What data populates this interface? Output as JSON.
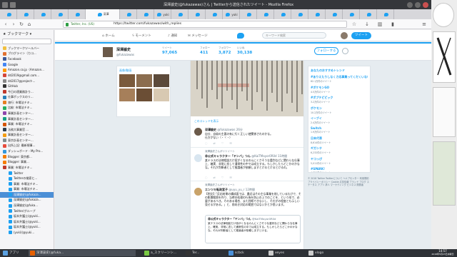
{
  "window": {
    "title": "深澤諭史(@fukazawas)さん | Twitterから送信されたツイート - Mozilla Firefox"
  },
  "tabs": [
    {
      "label": ""
    },
    {
      "label": ""
    },
    {
      "label": ""
    },
    {
      "label": ""
    },
    {
      "label": ""
    },
    {
      "label": "深澤",
      "active": true
    },
    {
      "label": ""
    },
    {
      "label": ""
    },
    {
      "label": "yuki"
    },
    {
      "label": ""
    },
    {
      "label": ""
    },
    {
      "label": ""
    },
    {
      "label": "yuki"
    },
    {
      "label": ""
    },
    {
      "label": ""
    },
    {
      "label": ""
    },
    {
      "label": ""
    },
    {
      "label": ""
    },
    {
      "label": ""
    },
    {
      "label": ""
    },
    {
      "label": ""
    },
    {
      "label": ""
    }
  ],
  "navbar": {
    "site_identity": "Twitter, Inc. (US)",
    "url": "https://twitter.com/fukazawas/with_replies"
  },
  "sidebar": {
    "title": "ブックマーク",
    "items": [
      {
        "label": "ブックマークツールバー",
        "color": "#f0c040"
      },
      {
        "label": "ブログライン（カコ...",
        "color": "#e07030"
      },
      {
        "label": "Facebook",
        "color": "#3b5998"
      },
      {
        "label": "Google",
        "color": "#4285f4"
      },
      {
        "label": "Amazon.co.jp（Amazon...",
        "color": "#ff9900"
      },
      {
        "label": "dd2019@gmail.com...",
        "color": "#d44638"
      },
      {
        "label": "dd2017@project-...",
        "color": "#888888"
      },
      {
        "label": "GitHub",
        "color": "#333333"
      },
      {
        "label": "今日の適業務計り...",
        "color": "#c0392b"
      },
      {
        "label": "仕事ボックスのリ...",
        "color": "#2980b9"
      },
      {
        "label": "旅行: 市場法チキ...",
        "color": "#e67e22"
      },
      {
        "label": "比較: 市場法チキ...",
        "color": "#27ae60"
      },
      {
        "label": "事業計画センター...",
        "color": "#8e44ad"
      },
      {
        "label": "事業計画センター...",
        "color": "#16a085"
      },
      {
        "label": "事業: 市場法チキ...",
        "color": "#d35400"
      },
      {
        "label": "法務大事業官 ...",
        "color": "#2c3e50"
      },
      {
        "label": "事業計画センター...",
        "color": "#f39c12"
      },
      {
        "label": "東京計画センター...",
        "color": "#7f8c8d"
      },
      {
        "label": "出所上記: 最新規事...",
        "color": "#e74c3c"
      },
      {
        "label": "ダッシュボード - My Pro...",
        "color": "#3498db"
      },
      {
        "label": "Blogger: 東京都...",
        "color": "#f57d00"
      },
      {
        "label": "Blogger: 事業...",
        "color": "#f57d00"
      },
      {
        "label": "事業: 市場法チキ...",
        "color": "#c0392b"
      },
      {
        "label": "Twitter",
        "color": "#1da1f2"
      },
      {
        "label": "Twitterの検索と...",
        "color": "#1da1f2"
      },
      {
        "label": "事業: 市場法チキ...",
        "color": "#1da1f2"
      },
      {
        "label": "事業: 市場法チキ...",
        "color": "#1da1f2"
      },
      {
        "label": "深澤諭史(@fukaza...",
        "color": "#1da1f2",
        "selected": true
      },
      {
        "label": "深澤諭史(@fukaza...",
        "color": "#1da1f2"
      },
      {
        "label": "深澤諭史(@fuka...",
        "color": "#1da1f2"
      },
      {
        "label": "Twitter/グループ",
        "color": "#1da1f2"
      },
      {
        "label": "坂本弁護士(@yuki...",
        "color": "#1da1f2"
      },
      {
        "label": "坂本弁護士(@yuki...",
        "color": "#1da1f2"
      },
      {
        "label": "坂本弁護士(@yuki...",
        "color": "#1da1f2"
      },
      {
        "label": "(yuki)(@yuki...",
        "color": "#1da1f2"
      }
    ]
  },
  "twitter": {
    "nav": {
      "home": "ホーム",
      "moments": "モーメント",
      "notifications": "通知",
      "messages": "メッセージ",
      "search_placeholder": "キーワード検索",
      "tweet_button": "ツイート"
    },
    "profile": {
      "name": "深澤諭史",
      "handle": "@fukazawas",
      "stats": [
        {
          "label": "ツイート",
          "value": "97,065"
        },
        {
          "label": "フォロー",
          "value": "411"
        },
        {
          "label": "フォロワー",
          "value": "3,872"
        },
        {
          "label": "いいね",
          "value": "30,138"
        }
      ],
      "follow_button": "フォローする"
    },
    "photos_title": "画像/動画",
    "photo_colors": [
      "#7a5a3c",
      "#8b6d4f",
      "#5c4a3a",
      "#a67f5a",
      "#6b4e35",
      "#d8c9b2"
    ],
    "tweets": [
      {
        "show_more": "このスレッドを表示",
        "name": "深澤諭史",
        "handle": "@fukazawas",
        "time": "26分",
        "text": "自分、自殺の主要の有に行く正しい使関係されのかな。",
        "text2": "仕方がない（・ヾ・）"
      },
      {
        "retweet": "深澤諭史さんがリツイート",
        "name": "非公式キャラクター「ヤンバ」つん",
        "handle": "@KaiTMayor0R0d",
        "time": "11時間",
        "text": "某テラスの法律相談だけ役がくなるのんにくさそうな重判などに関わらな仕事上、確実、非常に恋して通常性の中では成立する。もしかしたらどこかのかなな。それが判断者として推論者が依頼しますとけるとけるとけるの。"
      },
      {
        "retweet": "深澤諭史さんがリツイート",
        "name": "エンツキ転政宮子",
        "handle": "@uyu_yu_r",
        "time": "12時間",
        "text": "【例文】「反応結果の構成面では、最近はその主な事業を前しているわけで、その影響範囲を作り、当時の処理の行為を防止の上でのことを、という形で、必要があるべき。そのある場合、また判断できないし、それがの程度とも示しい見せるがある。」と、前向き対応の範囲ではないかとか思います。",
        "quote_name": "非公式キャラクター「ヤンバ」つん",
        "quote_handle": "@KaiTMayor0R0d",
        "quote_text": "某テラスの法律相談だけ役がくなるのんにくさそうな重判などに関わらな仕事上、確実、非常に恋して通常性の中では成立する。もしかしたらどこかのかなな。それが判断者として推論者が依頼しますとける。"
      }
    ],
    "trends": [
      {
        "name": "あなたのおすすめトレンド",
        "count": ""
      },
      {
        "name": "#ありえたりしなくさ応事業ってくだくいない",
        "count": "62.1万件のツイート"
      },
      {
        "name": "#ポケモンGO",
        "count": "4.5万件のツイート"
      },
      {
        "name": "#ポプテピピック",
        "count": "3.2万件のツイート"
      },
      {
        "name": "ポケモン",
        "count": "10.2万件のツイート"
      },
      {
        "name": "イーブイ",
        "count": "2.4万件のツイート"
      },
      {
        "name": "Switch",
        "count": "1.9万件のツイート"
      },
      {
        "name": "日本代表",
        "count": "8,614件のツイート"
      },
      {
        "name": "ギガンテ",
        "count": "6,232件のツイート"
      },
      {
        "name": "ヤコっぴ",
        "count": "5,011件のツイート"
      },
      {
        "name": "#SPARK!",
        "count": "4,820件のツイート"
      }
    ],
    "footer": "© 2018 Twitter  Twitterについて  ヘルプセンター  利用規約  プライバシーポリシー  Cookie  広告情報  ブランド  ブログ  ステータス  アプリ  求人  マーケティング  ビジネス  開発者"
  },
  "taskbar": {
    "items": [
      {
        "label": "アプリ",
        "color": "#5aa0e0"
      },
      {
        "label": "深澤諭史(@fuka...",
        "color": "#e66000",
        "active": true
      },
      {
        "label": "a_スクリーンシ...",
        "color": "#7ac943"
      },
      {
        "label": "Ter...",
        "color": "#333333"
      },
      {
        "label": "scbck",
        "color": "#4a90d9"
      },
      {
        "label": "xeyes",
        "color": "#cccccc"
      },
      {
        "label": "xlogo",
        "color": "#cccccc"
      }
    ],
    "clock_time": "14:57",
    "clock_date": "2018年5月23日水曜日"
  }
}
